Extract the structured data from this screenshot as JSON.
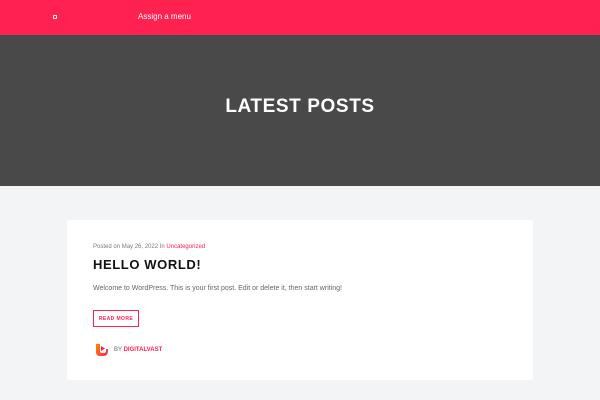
{
  "header": {
    "menu_label": "Assign a menu",
    "brand_color": "#ff2150",
    "logo_icon": "home-icon"
  },
  "hero": {
    "title": "LATEST POSTS",
    "background": "#4a4949"
  },
  "post": {
    "meta_prefix": "Posted on",
    "date": "May 26, 2022",
    "in_label": "In",
    "category": "Uncategorized",
    "title": "HELLO WORLD!",
    "excerpt": "Welcome to WordPress. This is your first post. Edit or delete it, then start writing!",
    "read_more": "READ MORE",
    "by_label": "BY",
    "author": "DIGITALVAST",
    "author_avatar_icon": "author-logo-icon"
  }
}
